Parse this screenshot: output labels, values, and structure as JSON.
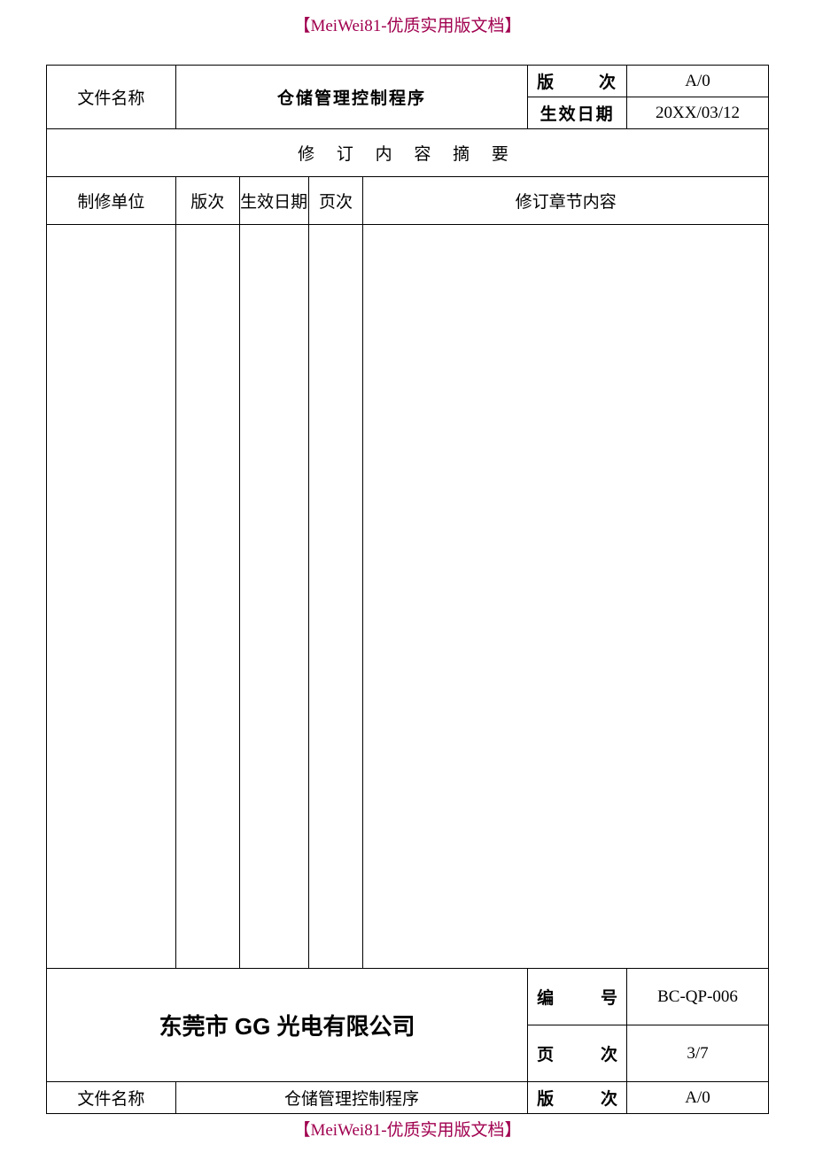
{
  "watermark": "【MeiWei81-优质实用版文档】",
  "row1": {
    "file_name_label": "文件名称",
    "file_name_value": "仓储管理控制程序",
    "version_label_a": "版",
    "version_label_b": "次",
    "version_value": "A/0",
    "effective_date_label": "生效日期",
    "effective_date_value": "20XX/03/12"
  },
  "summary": "修 订 内 容 摘 要",
  "columns": {
    "c1": "制修单位",
    "c2": "版次",
    "c3": "生效日期",
    "c4": "页次",
    "c5": "修订章节内容"
  },
  "footer": {
    "company": "东莞市 GG 光电有限公司",
    "code_label_a": "编",
    "code_label_b": "号",
    "code_value": "BC-QP-006",
    "page_label_a": "页",
    "page_label_b": "次",
    "page_value": "3/7",
    "file_name_label": "文件名称",
    "file_name_value": "仓储管理控制程序",
    "version_label_a": "版",
    "version_label_b": "次",
    "version_value": "A/0"
  }
}
